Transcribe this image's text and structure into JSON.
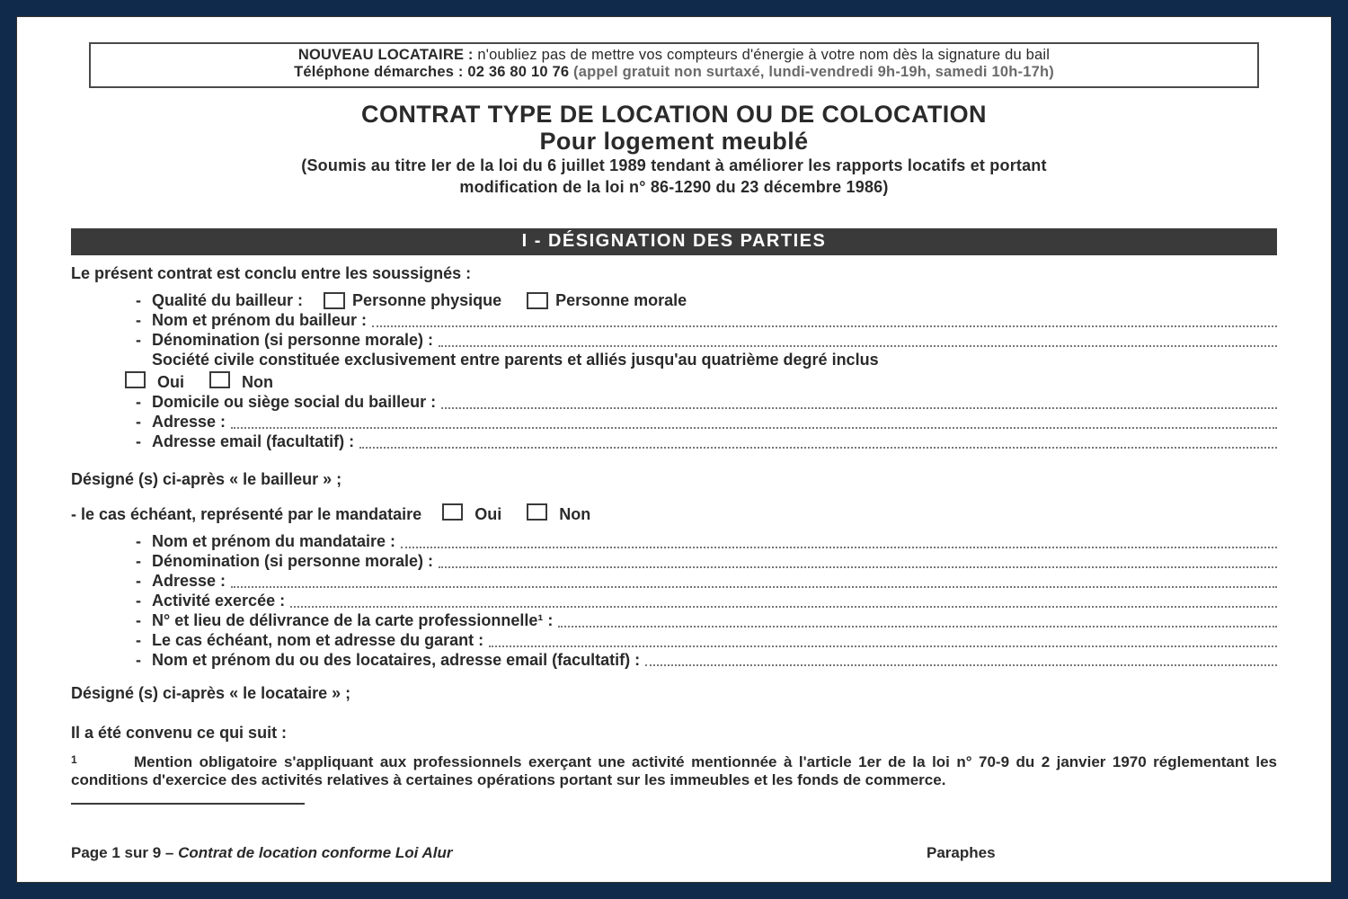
{
  "notice": {
    "line1_bold": "NOUVEAU LOCATAIRE :",
    "line1_rest": " n'oubliez pas de mettre vos compteurs d'énergie à votre nom dès la signature du bail",
    "line2_bold": "Téléphone démarches : 02 36 80 10 76",
    "line2_dim": " (appel gratuit non surtaxé, lundi-vendredi 9h-19h, samedi 10h-17h)"
  },
  "title": {
    "main1": "CONTRAT TYPE DE LOCATION OU DE COLOCATION",
    "main2": "Pour logement meublé",
    "law1": "(Soumis au titre Ier de la loi du 6 juillet 1989 tendant à améliorer les rapports locatifs et portant",
    "law2": "modification de la loi n° 86-1290 du 23 décembre 1986)"
  },
  "section_heading": "I - DÉSIGNATION DES PARTIES",
  "texts": {
    "intro": "Le présent contrat est conclu entre les soussignés :",
    "designe_bailleur_pre": "Désigné (s) ci-après « ",
    "designe_bailleur_bold": "le bailleur",
    "designe_bailleur_post": " » ;",
    "mandataire_line": "- le cas échéant, représenté par le mandataire",
    "designe_locataire_pre": " Désigné (s) ci-après « ",
    "designe_locataire_bold": "le locataire",
    "designe_locataire_post": " » ;",
    "convenu": "Il a été convenu ce qui suit :",
    "oui": "Oui",
    "non": "Non"
  },
  "bailleur": {
    "qualite": "Qualité du bailleur :",
    "pp": "Personne physique",
    "pm": "Personne morale",
    "nom": "Nom et prénom du bailleur :",
    "denom": "Dénomination (si personne morale) :",
    "societe": "Société civile constituée exclusivement entre parents et alliés jusqu'au quatrième degré inclus",
    "domicile": "Domicile ou siège social du bailleur :",
    "adresse": "Adresse :",
    "email": "Adresse email (facultatif) :"
  },
  "mandataire": {
    "nom": "Nom et prénom du mandataire :",
    "denom": "Dénomination (si personne morale) :",
    "adresse": "Adresse :",
    "activite": "Activité exercée :",
    "carte": "N° et lieu de délivrance de la carte professionnelle¹ :",
    "garant": "Le cas échéant, nom et adresse du garant :",
    "locataires": "Nom et prénom du ou des locataires, adresse email (facultatif) :"
  },
  "footnote": {
    "marker": "1",
    "text": "Mention obligatoire s'appliquant aux professionnels exerçant une activité mentionnée à l'article 1er de la loi n° 70-9 du 2 janvier 1970 réglementant les conditions d'exercice des activités relatives à certaines opérations portant sur les immeubles et les fonds de commerce."
  },
  "footer": {
    "page_pre": "Page ",
    "page_cur": "1",
    "page_mid": " sur ",
    "page_tot": "9",
    "dash": " – ",
    "doc_title": "Contrat de location conforme Loi Alur",
    "paraphes": "Paraphes"
  }
}
